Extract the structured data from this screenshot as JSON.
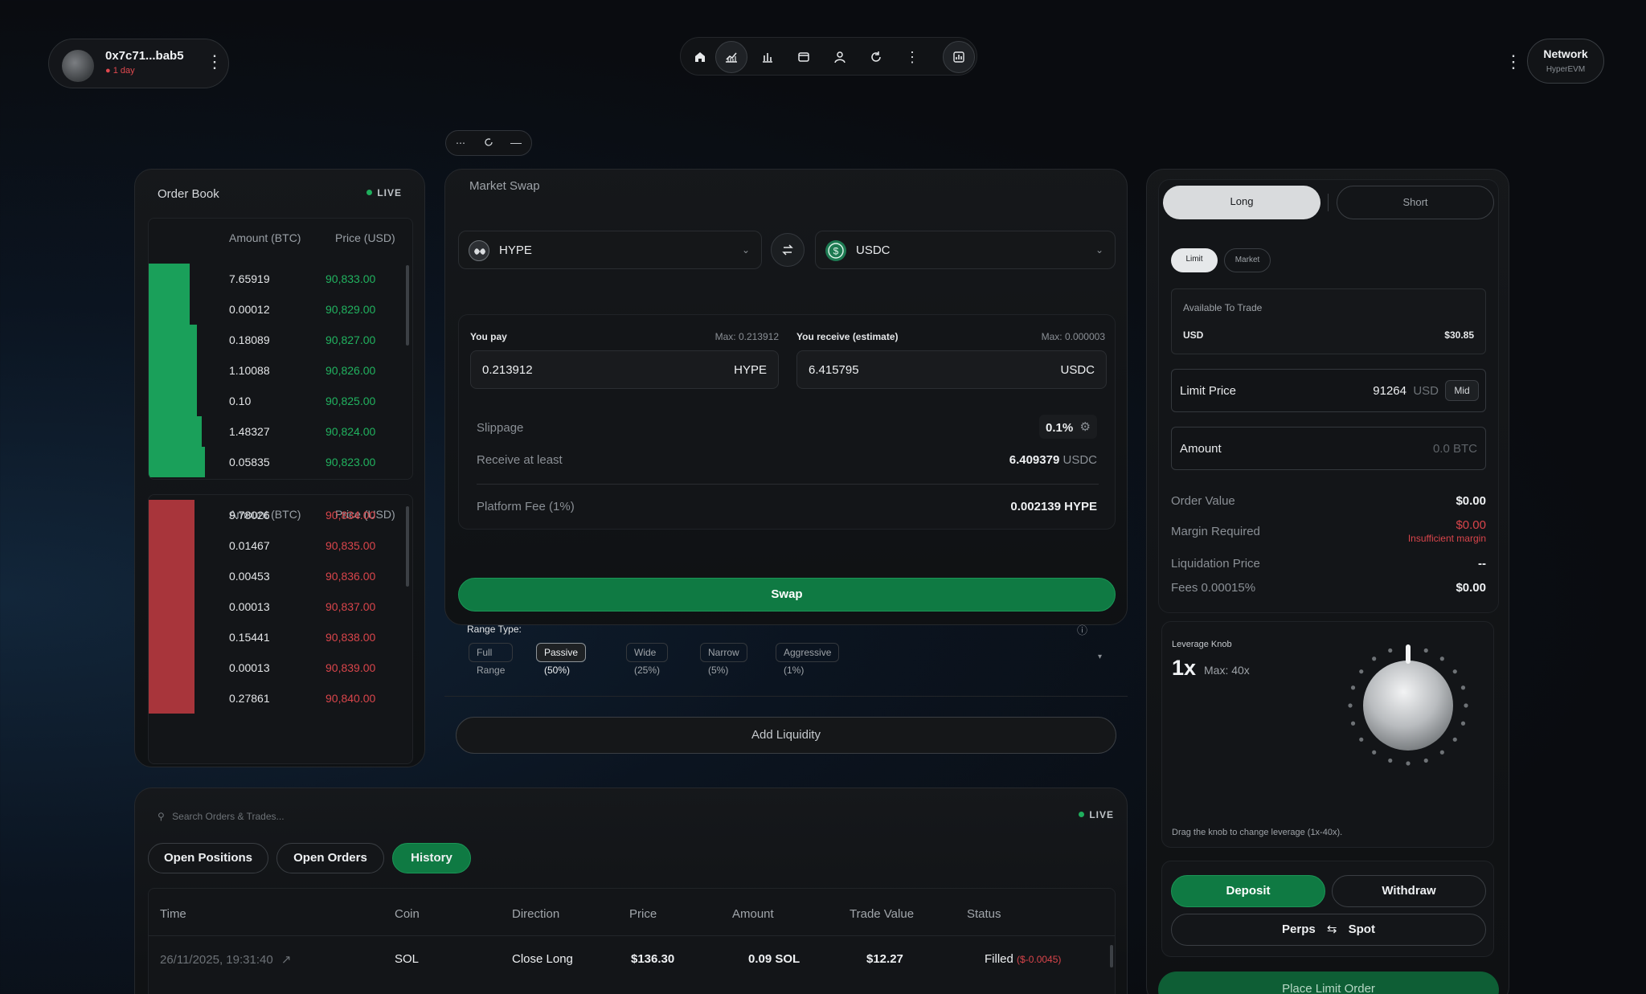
{
  "account": {
    "address": "0x7c71...bab5",
    "age": "1 day"
  },
  "nav": {
    "icons": [
      "home-icon",
      "chart-line-icon",
      "bar-chart-icon",
      "wallet-icon",
      "user-icon",
      "refresh-icon",
      "more-icon",
      "analytics-icon"
    ]
  },
  "network": {
    "title": "Network",
    "name": "HyperEVM"
  },
  "orderbook": {
    "title": "Order Book",
    "live": "LIVE",
    "amount_header": "Amount (BTC)",
    "price_header": "Price (USD)",
    "bids": [
      {
        "amount": "7.65919",
        "price": "90,833.00",
        "depth": 0.16
      },
      {
        "amount": "0.00012",
        "price": "90,829.00",
        "depth": 0.16
      },
      {
        "amount": "0.18089",
        "price": "90,827.00",
        "depth": 0.19
      },
      {
        "amount": "1.10088",
        "price": "90,826.00",
        "depth": 0.19
      },
      {
        "amount": "0.10",
        "price": "90,825.00",
        "depth": 0.19
      },
      {
        "amount": "1.48327",
        "price": "90,824.00",
        "depth": 0.21
      },
      {
        "amount": "0.05835",
        "price": "90,823.00",
        "depth": 0.22
      }
    ],
    "asks": [
      {
        "amount": "9.78026",
        "price": "90,834.00",
        "depth": 0.18
      },
      {
        "amount": "0.01467",
        "price": "90,835.00",
        "depth": 0.18
      },
      {
        "amount": "0.00453",
        "price": "90,836.00",
        "depth": 0.18
      },
      {
        "amount": "0.00013",
        "price": "90,837.00",
        "depth": 0.18
      },
      {
        "amount": "0.15441",
        "price": "90,838.00",
        "depth": 0.18
      },
      {
        "amount": "0.00013",
        "price": "90,839.00",
        "depth": 0.18
      },
      {
        "amount": "0.27861",
        "price": "90,840.00",
        "depth": 0.18
      }
    ]
  },
  "swap": {
    "title": "Market Swap",
    "from_token": "HYPE",
    "to_token": "USDC",
    "you_pay": "You pay",
    "pay_max": "Max: 0.213912",
    "pay_value": "0.213912",
    "pay_unit": "HYPE",
    "you_receive": "You receive (estimate)",
    "receive_max": "Max: 0.000003",
    "receive_value": "6.415795",
    "receive_unit": "USDC",
    "slippage_label": "Slippage",
    "slippage_value": "0.1%",
    "receive_least_label": "Receive at least",
    "receive_least_value": "6.409379",
    "receive_least_unit": "USDC",
    "fee_label": "Platform Fee (1%)",
    "fee_value": "0.002139 HYPE",
    "swap_button": "Swap",
    "range_type": "Range Type:",
    "ranges": [
      "Full Range",
      "Passive (50%)",
      "Wide (25%)",
      "Narrow (5%)",
      "Aggressive (1%)"
    ],
    "selected_range": "Passive (50%)",
    "add_liquidity": "Add Liquidity"
  },
  "trade": {
    "long": "Long",
    "short": "Short",
    "limit": "Limit",
    "market": "Market",
    "available_label": "Available To Trade",
    "available_currency": "USD",
    "available_value": "$30.85",
    "limit_price_label": "Limit Price",
    "limit_price_value": "91264",
    "limit_price_unit": "USD",
    "mid": "Mid",
    "amount_label": "Amount",
    "amount_placeholder": "0.0 BTC",
    "order_value_label": "Order Value",
    "order_value": "$0.00",
    "margin_label": "Margin Required",
    "margin_value": "$0.00",
    "margin_warning": "Insufficient margin",
    "liq_label": "Liquidation Price",
    "liq_value": "--",
    "fees_label": "Fees 0.00015%",
    "fees_value": "$0.00",
    "leverage_label": "Leverage Knob",
    "leverage_value": "1x",
    "leverage_max": "Max: 40x",
    "leverage_hint": "Drag the knob to change leverage (1x-40x).",
    "leverage_level": 1,
    "deposit": "Deposit",
    "withdraw": "Withdraw",
    "perps": "Perps",
    "spot": "Spot",
    "place_order": "Place Limit Order"
  },
  "orders": {
    "search_placeholder": "Search Orders & Trades...",
    "live": "LIVE",
    "tabs": [
      "Open Positions",
      "Open Orders",
      "History"
    ],
    "active_tab": "History",
    "columns": [
      "Time",
      "Coin",
      "Direction",
      "Price",
      "Amount",
      "Trade Value",
      "Status"
    ],
    "rows": [
      {
        "time": "26/11/2025, 19:31:40",
        "coin": "SOL",
        "direction": "Close Long",
        "price": "$136.30",
        "amount": "0.09 SOL",
        "value": "$12.27",
        "status": "Filled",
        "pnl": "($-0.0045)"
      }
    ]
  },
  "colors": {
    "accent": "#0f7a43",
    "bid": "#1aa05a",
    "ask": "#a8353b"
  }
}
